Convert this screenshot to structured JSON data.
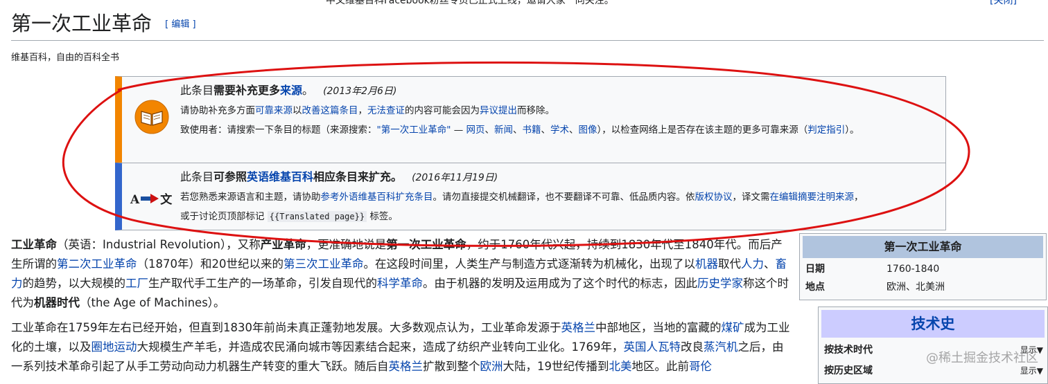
{
  "site_notice": {
    "text": "中文维基百科Facebook粉丝专页已正式上线，邀请大家一同关注。",
    "hide": "[关闭]"
  },
  "page": {
    "title": "第一次工业革命",
    "edit_label": "[ 编辑 ]",
    "tagline": "维基百科，自由的百科全书"
  },
  "notice_refimprove": {
    "prefix": "此条目",
    "bold": "需要补充更多",
    "link": "来源",
    "end": "。",
    "date": "(2013年2月6日)",
    "l2_a": "请协助补充多方面",
    "l2_link1": "可靠来源",
    "l2_b": "以",
    "l2_link2": "改善这篇条目",
    "l2_c": "，",
    "l2_link3": "无法查证",
    "l2_d": "的内容可能会因为",
    "l2_link4": "异议提出",
    "l2_e": "而移除。",
    "l3_a": "致使用者：请搜索一下条目的标题（来源搜索：",
    "l3_link1": "\"第一次工业革命\"",
    "l3_b": " — ",
    "l3_link2": "网页",
    "l3_link3": "新闻",
    "l3_link4": "书籍",
    "l3_link5": "学术",
    "l3_link6": "图像",
    "l3_c": "），以检查网络上是否存在该主题的更多可靠来源（",
    "l3_link7": "判定指引",
    "l3_d": "）。",
    "sep": "、"
  },
  "notice_expand": {
    "prefix": "此条目",
    "bold1": "可参照",
    "link": "英语维基百科",
    "bold2": "相应条目来扩充。",
    "date": "(2016年11月19日)",
    "l2_a": "若您熟悉来源语言和主题，请协助",
    "l2_link1": "参考外语维基百科扩充条目",
    "l2_b": "。请勿直接提交机械翻译，也不要翻译不可靠、低品质内容。依",
    "l2_link2": "版权协议",
    "l2_c": "，译文需",
    "l2_link3": "在编辑摘要注明来源",
    "l2_d": "，",
    "l3_a": "或于讨论页顶部标记 ",
    "l3_code": "{{Translated page}}",
    "l3_b": " 标签。",
    "icon_a": "A",
    "icon_b": "文"
  },
  "article": {
    "p1": {
      "t1": "工业革命",
      "t2": "（英语：Industrial Revolution），又称",
      "t3": "产业革命",
      "t4": "，更准确地说是",
      "t5": "第一次工业革命",
      "t6": "，约于1760年代兴起，持续到1830年代至1840年代。而后产生所谓的",
      "l1": "第二次工业革命",
      "t7": "（1870年）和20世纪以来的",
      "l2": "第三次工业革命",
      "t8": "。在这段时间里，人类生产与制造方式逐渐转为机械化，出现了以",
      "l3": "机器",
      "t9": "取代",
      "l4": "人力",
      "t10": "、",
      "l5": "畜力",
      "t11": "的趋势，以大规模的",
      "l6": "工厂",
      "t12": "生产取代手工生产的一场革命，引发自现代的",
      "l7": "科学革命",
      "t13": "。由于机器的发明及运用成为了这个时代的标志，因此",
      "l8": "历史学家",
      "t14": "称这个时代为",
      "t15": "机器时代",
      "t16": "（the Age of Machines）。"
    },
    "p2": {
      "t1": "工业革命在1759年左右已经开始，但直到1830年前尚未真正蓬勃地发展。大多数观点认为，工业革命发源于",
      "l1": "英格兰",
      "t2": "中部地区，当地的富藏的",
      "l2": "煤矿",
      "t3": "成为工业化的土壤，以及",
      "l3": "圈地运动",
      "t4": "大规模生产羊毛，并造成农民涌向城市等因素结合起来，造成了纺织产业转向工业化。1769年，",
      "l4": "英国人瓦特",
      "t5": "改良",
      "l5": "蒸汽机",
      "t6": "之后，由一系列技术革命引起了从手工劳动向动力机器生产转变的重大飞跃。随后自",
      "l6": "英格兰",
      "t7": "扩散到整个",
      "l7": "欧洲",
      "t8": "大陆，19世纪传播到",
      "l8": "北美",
      "t9": "地区。此前",
      "l9": "哥伦"
    }
  },
  "infobox": {
    "title": "第一次工业革命",
    "rows": [
      {
        "k": "日期",
        "v": "1760-1840"
      },
      {
        "k": "地点",
        "v": "欧洲、北美洲"
      }
    ]
  },
  "navbox": {
    "title": "技术史",
    "rows": [
      {
        "k": "按技术时代",
        "t": "显示▼"
      },
      {
        "k": "按历史区域",
        "t": "显示▼"
      }
    ]
  },
  "watermark": "@稀土掘金技术社区",
  "colors": {
    "link": "#0645ad",
    "refimprove_bar": "#f28500",
    "expand_bar": "#3366cc",
    "annotation_circle": "#dd1111",
    "infobox_header": "#b0c4de",
    "navbox_header": "#ccccff"
  }
}
